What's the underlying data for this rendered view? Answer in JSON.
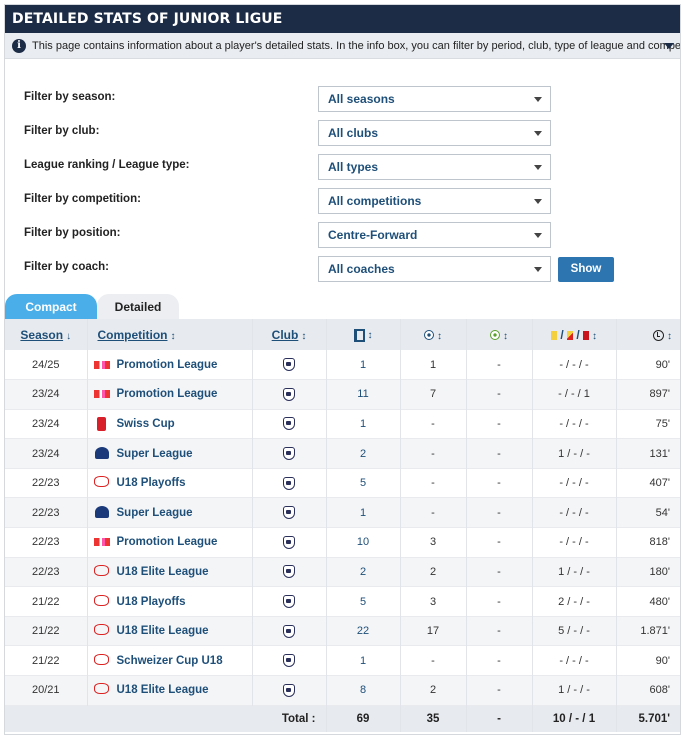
{
  "header": {
    "title": "DETAILED STATS OF JUNIOR LIGUE"
  },
  "info": {
    "icon": "info-icon",
    "text": "This page contains information about a player's detailed stats. In the info box, you can filter by period, club, type of league and competition. Th..."
  },
  "filters": [
    {
      "label": "Filter by season:",
      "value": "All seasons"
    },
    {
      "label": "Filter by club:",
      "value": "All clubs"
    },
    {
      "label": "League ranking / League type:",
      "value": "All types"
    },
    {
      "label": "Filter by competition:",
      "value": "All competitions"
    },
    {
      "label": "Filter by position:",
      "value": "Centre-Forward"
    },
    {
      "label": "Filter by coach:",
      "value": "All coaches"
    }
  ],
  "show_button": "Show",
  "tabs": {
    "compact": "Compact",
    "detailed": "Detailed"
  },
  "table": {
    "headers": {
      "season": "Season",
      "competition": "Competition",
      "club": "Club",
      "cards_sep": "/ /"
    },
    "rows": [
      {
        "season": "24/25",
        "logo": "promotion-league-logo",
        "competition": "Promotion League",
        "apps": "1",
        "goals": "1",
        "assists": "-",
        "cards": "- / - / -",
        "minutes": "90'"
      },
      {
        "season": "23/24",
        "logo": "promotion-league-logo",
        "competition": "Promotion League",
        "apps": "11",
        "goals": "7",
        "assists": "-",
        "cards": "- / - / 1",
        "minutes": "897'"
      },
      {
        "season": "23/24",
        "logo": "swiss-cup-logo",
        "competition": "Swiss Cup",
        "apps": "1",
        "goals": "-",
        "assists": "-",
        "cards": "- / - / -",
        "minutes": "75'"
      },
      {
        "season": "23/24",
        "logo": "super-league-logo",
        "competition": "Super League",
        "apps": "2",
        "goals": "-",
        "assists": "-",
        "cards": "1 / - / -",
        "minutes": "131'"
      },
      {
        "season": "22/23",
        "logo": "u18-logo",
        "competition": "U18 Playoffs",
        "apps": "5",
        "goals": "-",
        "assists": "-",
        "cards": "- / - / -",
        "minutes": "407'"
      },
      {
        "season": "22/23",
        "logo": "super-league-logo",
        "competition": "Super League",
        "apps": "1",
        "goals": "-",
        "assists": "-",
        "cards": "- / - / -",
        "minutes": "54'"
      },
      {
        "season": "22/23",
        "logo": "promotion-league-logo",
        "competition": "Promotion League",
        "apps": "10",
        "goals": "3",
        "assists": "-",
        "cards": "- / - / -",
        "minutes": "818'"
      },
      {
        "season": "22/23",
        "logo": "u18-logo",
        "competition": "U18 Elite League",
        "apps": "2",
        "goals": "2",
        "assists": "-",
        "cards": "1 / - / -",
        "minutes": "180'"
      },
      {
        "season": "21/22",
        "logo": "u18-logo",
        "competition": "U18 Playoffs",
        "apps": "5",
        "goals": "3",
        "assists": "-",
        "cards": "2 / - / -",
        "minutes": "480'"
      },
      {
        "season": "21/22",
        "logo": "u18-logo",
        "competition": "U18 Elite League",
        "apps": "22",
        "goals": "17",
        "assists": "-",
        "cards": "5 / - / -",
        "minutes": "1.871'"
      },
      {
        "season": "21/22",
        "logo": "u18-logo",
        "competition": "Schweizer Cup U18",
        "apps": "1",
        "goals": "-",
        "assists": "-",
        "cards": "- / - / -",
        "minutes": "90'"
      },
      {
        "season": "20/21",
        "logo": "u18-logo",
        "competition": "U18 Elite League",
        "apps": "8",
        "goals": "2",
        "assists": "-",
        "cards": "1 / - / -",
        "minutes": "608'"
      }
    ],
    "totals": {
      "label": "Total :",
      "apps": "69",
      "goals": "35",
      "assists": "-",
      "cards": "10 / - / 1",
      "minutes": "5.701'"
    }
  },
  "colors": {
    "header_bg": "#1d2c46",
    "link": "#1e4f79",
    "tab_active": "#4aaee8",
    "button": "#2d75b0"
  }
}
